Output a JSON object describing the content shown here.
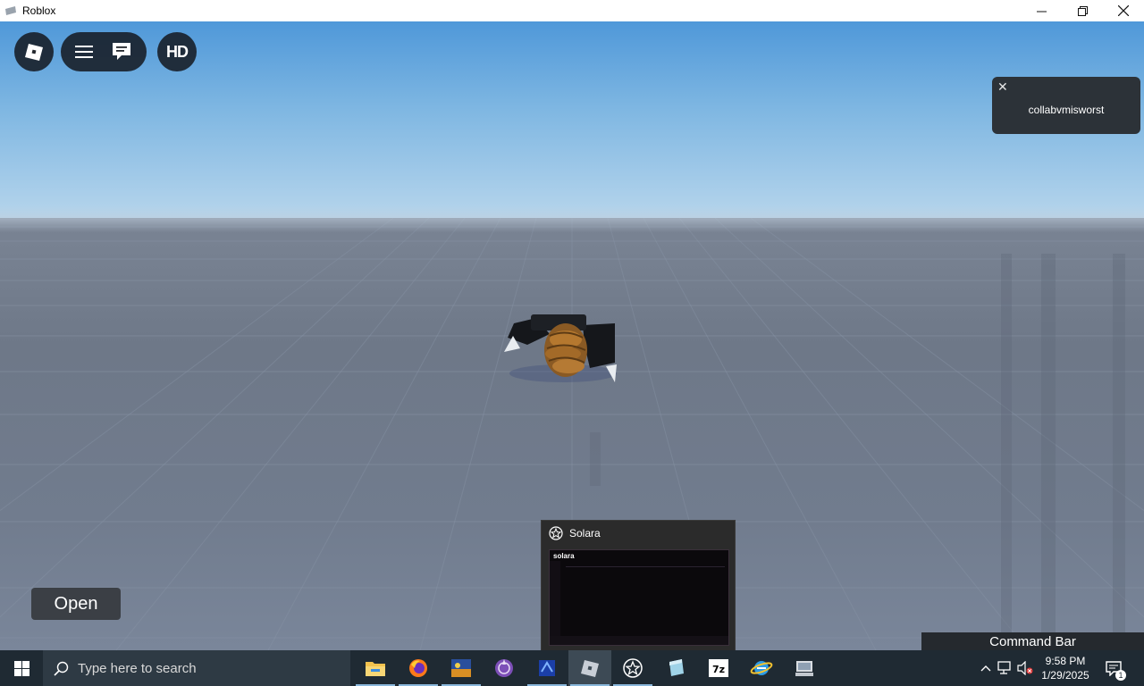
{
  "window": {
    "title": "Roblox",
    "controls": [
      "minimize",
      "restore",
      "close"
    ]
  },
  "game_ui": {
    "hd_label": "HD",
    "notification": {
      "text": "collabvmisworst",
      "close_glyph": "✕"
    },
    "open_button": "Open",
    "command_bar": "Command Bar"
  },
  "taskbar_preview": {
    "title": "Solara",
    "thumbnail_title": "solara"
  },
  "taskbar": {
    "search_placeholder": "Type here to search",
    "apps": [
      {
        "name": "file-explorer",
        "active": true
      },
      {
        "name": "firefox",
        "active": true
      },
      {
        "name": "app-3",
        "active": true
      },
      {
        "name": "app-4",
        "active": false
      },
      {
        "name": "app-5",
        "active": true
      },
      {
        "name": "roblox",
        "active": true,
        "focused": true
      },
      {
        "name": "solara",
        "active": true
      },
      {
        "name": "app-8",
        "active": false
      },
      {
        "name": "7zip",
        "active": false
      },
      {
        "name": "internet-explorer",
        "active": false
      },
      {
        "name": "app-11",
        "active": false
      }
    ],
    "time": "9:58 PM",
    "date": "1/29/2025",
    "notification_count": "1"
  },
  "colors": {
    "taskbar": "#1f2a33",
    "sky_top": "#4f98d9",
    "sky_bottom": "#b6d5ec",
    "baseplate": "#717c8e",
    "toast": "#2c3238"
  }
}
